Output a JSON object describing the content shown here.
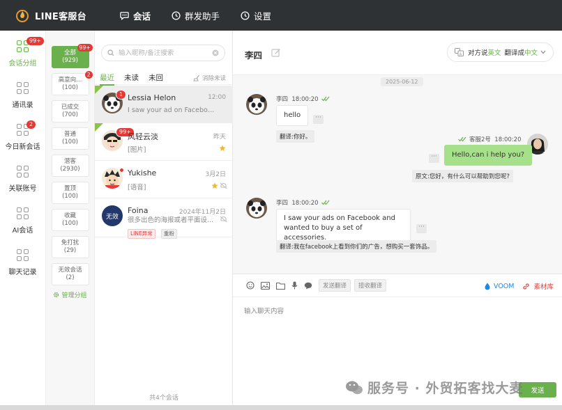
{
  "app": {
    "title": "LINE客服台"
  },
  "topnav": [
    {
      "label": "会话",
      "icon": "chat-bubble-icon",
      "active": true
    },
    {
      "label": "群发助手",
      "icon": "clock-icon",
      "active": false
    },
    {
      "label": "设置",
      "icon": "clock-icon",
      "active": false
    }
  ],
  "rail": [
    {
      "label": "会话分组",
      "badge": "99+",
      "active": true
    },
    {
      "label": "通讯录",
      "badge": "",
      "active": false
    },
    {
      "label": "今日新会话",
      "badge": "2",
      "active": false
    },
    {
      "label": "关联账号",
      "badge": "",
      "active": false
    },
    {
      "label": "AI会话",
      "badge": "",
      "active": false
    },
    {
      "label": "聊天记录",
      "badge": "",
      "active": false
    }
  ],
  "groups": [
    {
      "name": "全部",
      "count": "(929)",
      "badge": "99+",
      "active": true
    },
    {
      "name": "高意向...",
      "count": "(100)",
      "badge": "2",
      "active": false
    },
    {
      "name": "已成交",
      "count": "(700)",
      "badge": "",
      "active": false
    },
    {
      "name": "普通",
      "count": "(100)",
      "badge": "",
      "active": false
    },
    {
      "name": "潜客",
      "count": "(2930)",
      "badge": "",
      "active": false
    },
    {
      "name": "置顶",
      "count": "(100)",
      "badge": "",
      "active": false
    },
    {
      "name": "收藏",
      "count": "(100)",
      "badge": "",
      "active": false
    },
    {
      "name": "免打扰",
      "count": "(29)",
      "badge": "",
      "active": false
    },
    {
      "name": "无效会话",
      "count": "(2)",
      "badge": "",
      "active": false
    }
  ],
  "manage_label": "管理分组",
  "search": {
    "placeholder": "输入昵称/备注搜索"
  },
  "tabs": [
    {
      "label": "最近",
      "active": true
    },
    {
      "label": "未读",
      "active": false
    },
    {
      "label": "未回",
      "active": false
    }
  ],
  "clear_unread": "消除未读",
  "conversations": [
    {
      "name": "Lessia Helon",
      "time": "12:00",
      "preview": "I saw your ad on Facebook....",
      "badge": "1",
      "selected": true
    },
    {
      "name": "风轻云淡",
      "time": "昨天",
      "preview": "[图片]",
      "badge": "99+",
      "selected": false
    },
    {
      "name": "Yukishe",
      "time": "3月2日",
      "preview": "[语音]",
      "badge": "",
      "selected": false
    },
    {
      "name": "Foina",
      "time": "2024年11月2日",
      "preview": "很多出色的海报或者平面设...",
      "badge": "",
      "selected": false,
      "avatar_text": "无效",
      "tags": [
        "LINE异常",
        "重粉"
      ]
    }
  ],
  "conv_footer": "共4个会话",
  "chat": {
    "title": "李四",
    "lang": {
      "prefix": "对方说",
      "from": "英文",
      "mid": "翻译成",
      "to": "中文"
    },
    "date": "2025-06-12",
    "messages": [
      {
        "meta": "李四  18:00:20",
        "text": "hello",
        "translation": "翻译:你好。"
      },
      {
        "meta": "客服2号  18:00:20",
        "text": "Hello,can i help you?",
        "translation": "原文:您好，有什么可以帮助到您呢?"
      },
      {
        "meta": "李四  18:00:20",
        "text_line1": "I saw your ads on Facebook and",
        "text_line2": "wanted to buy a set of accessories.",
        "translation": "翻译:我在facebook上看到你们的广告，想购买一套饰品。"
      }
    ],
    "more": "···",
    "toolbar": {
      "send_translate": "发送翻译",
      "receive_translate": "接收翻译",
      "voom": "VOOM",
      "assets": "素材库"
    },
    "compose": {
      "placeholder": "输入聊天内容",
      "send": "发送"
    }
  },
  "watermark": "服务号 · 外贸拓客找大麦",
  "colors": {
    "accent": "#6ab04c",
    "topbar": "#2f3235",
    "badge": "#e53935",
    "out_bubble": "#a6e08a"
  }
}
